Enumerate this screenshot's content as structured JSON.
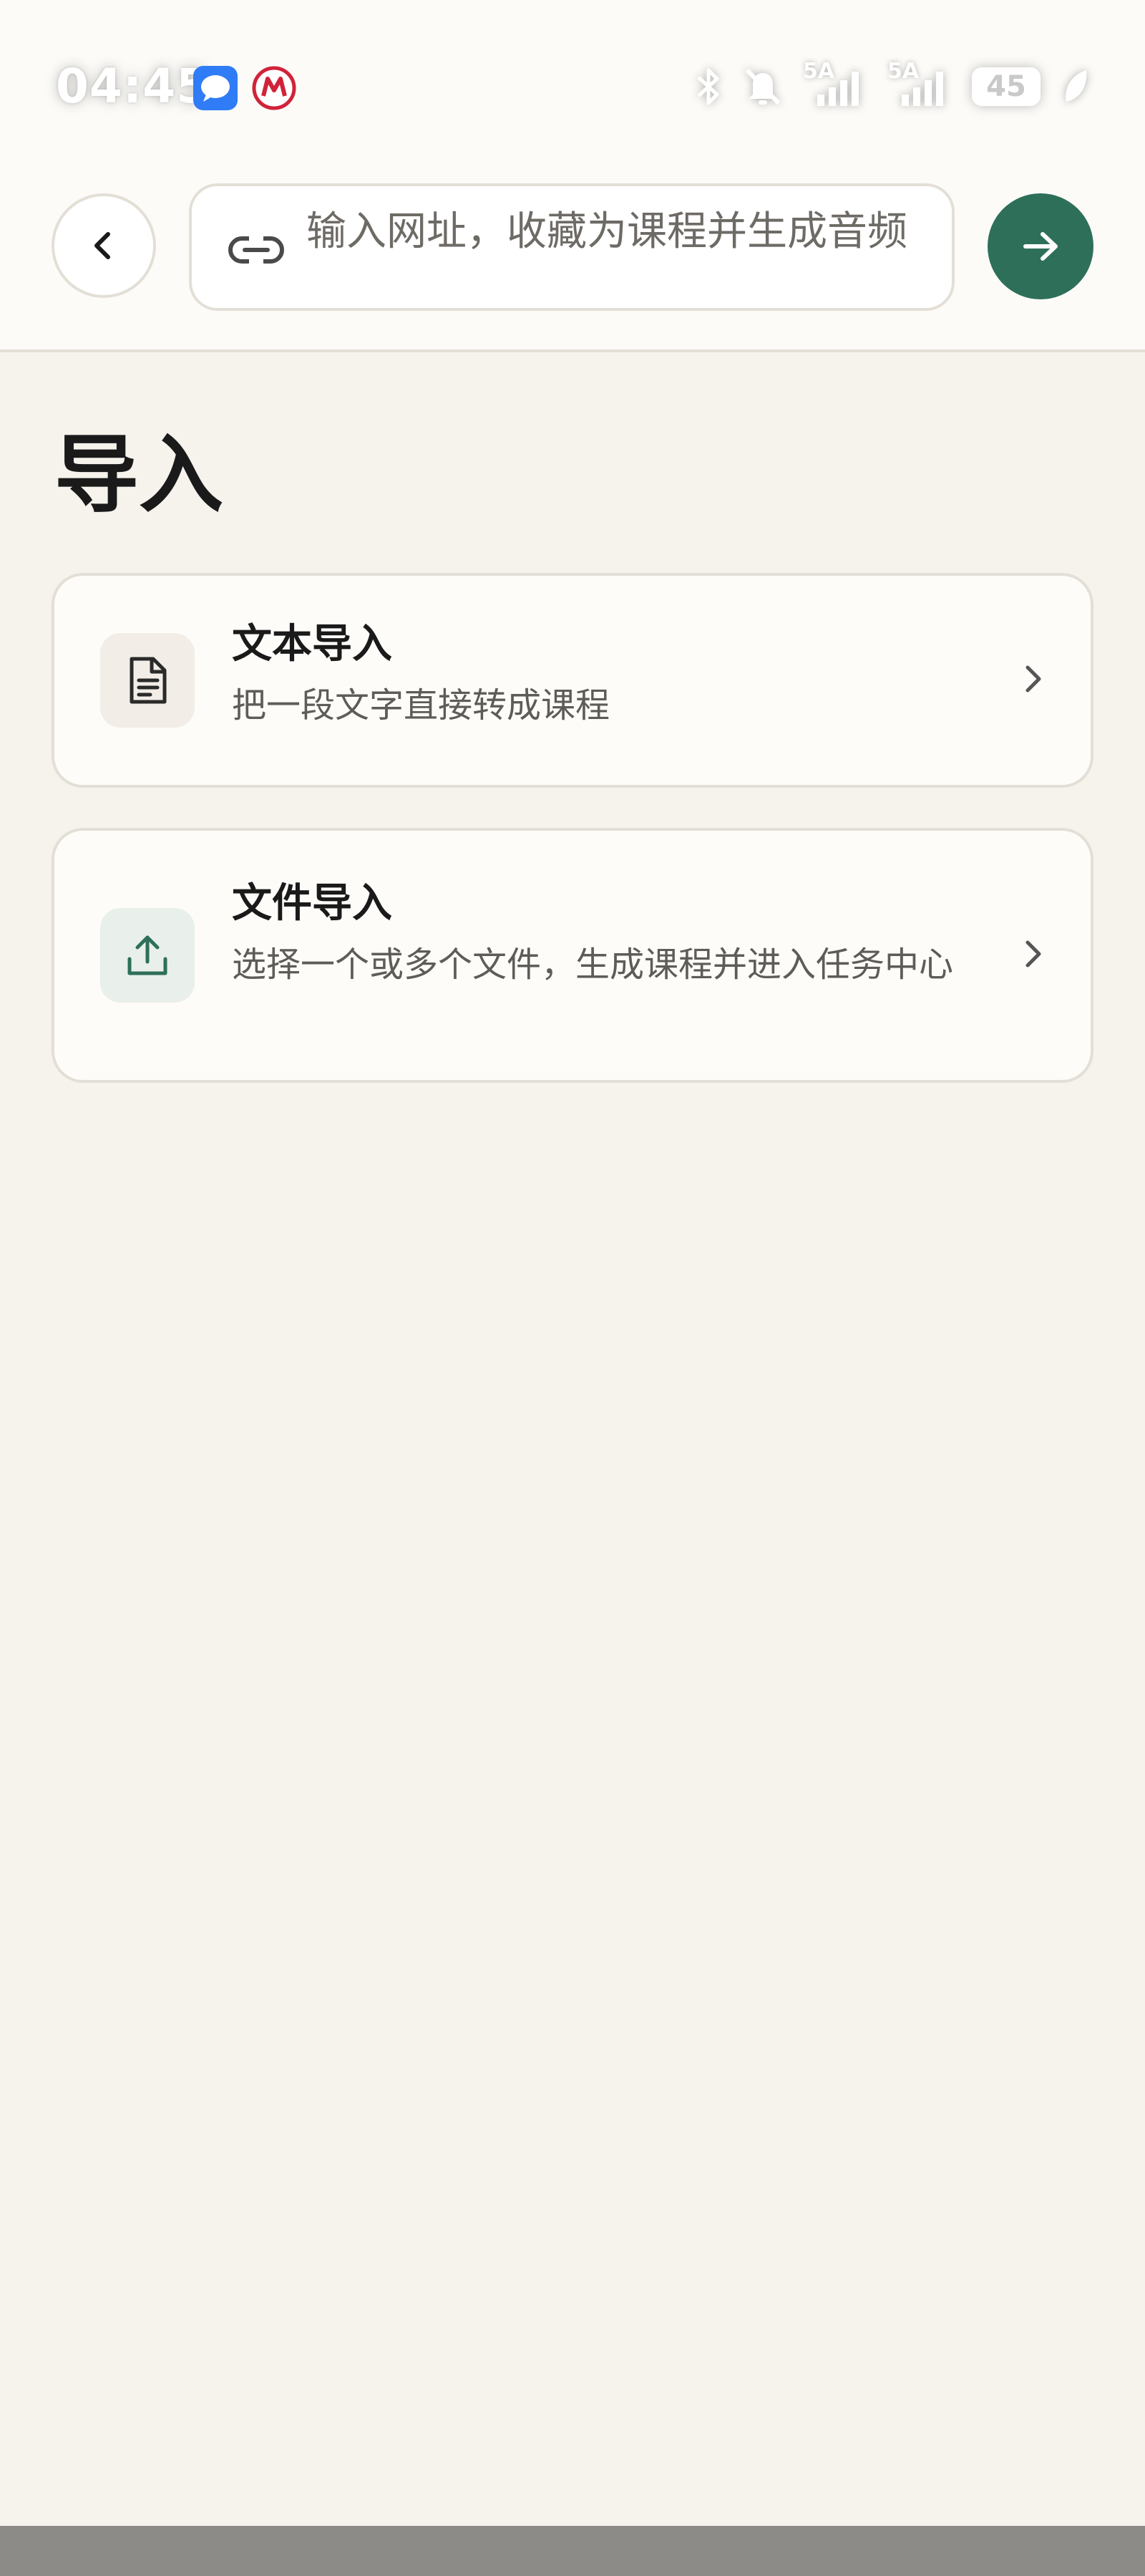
{
  "status_bar": {
    "time": "04:45",
    "network_1": "5A",
    "network_2": "5A",
    "battery_level": "45",
    "notification_icons": [
      "message-app-icon",
      "bank-app-icon"
    ],
    "system_icons": [
      "bluetooth-icon",
      "bell-off-icon",
      "signal-icon",
      "signal-icon",
      "battery-icon",
      "leaf-icon"
    ]
  },
  "top_bar": {
    "url_placeholder": "输入网址，收藏为课程并生成音频",
    "url_value": "",
    "accent_color": "#2e6f5a"
  },
  "page": {
    "title": "导入"
  },
  "cards": [
    {
      "title": "文本导入",
      "description": "把一段文字直接转成课程",
      "icon": "document-icon"
    },
    {
      "title": "文件导入",
      "description": "选择一个或多个文件，生成课程并进入任务中心",
      "icon": "upload-icon"
    }
  ]
}
